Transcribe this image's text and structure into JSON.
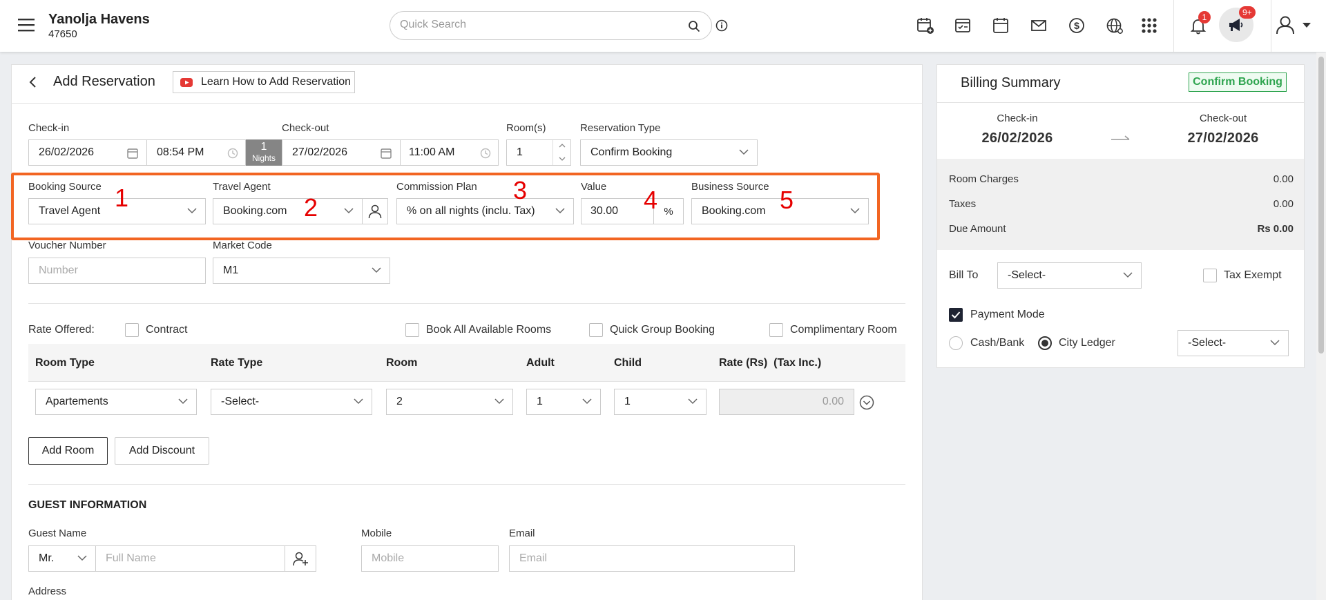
{
  "header": {
    "hotel_name": "Yanolja Havens",
    "hotel_id": "47650",
    "search_placeholder": "Quick Search",
    "notification_count": "1",
    "announcement_count": "9+"
  },
  "page": {
    "title": "Add Reservation",
    "learn_label": "Learn How to Add Reservation"
  },
  "stay": {
    "checkin_label": "Check-in",
    "checkin_date": "26/02/2026",
    "checkin_time": "08:54 PM",
    "nights_count": "1",
    "nights_label": "Nights",
    "checkout_label": "Check-out",
    "checkout_date": "27/02/2026",
    "checkout_time": "11:00 AM",
    "rooms_label": "Room(s)",
    "rooms_value": "1",
    "type_label": "Reservation Type",
    "type_value": "Confirm Booking"
  },
  "source": {
    "booking_source_label": "Booking Source",
    "booking_source_value": "Travel Agent",
    "travel_agent_label": "Travel Agent",
    "travel_agent_value": "Booking.com",
    "commission_label": "Commission Plan",
    "commission_value": "% on all nights (inclu. Tax)",
    "value_label": "Value",
    "value_value": "30.00",
    "value_unit": "%",
    "business_source_label": "Business Source",
    "business_source_value": "Booking.com",
    "markers": [
      "1",
      "2",
      "3",
      "4",
      "5"
    ]
  },
  "misc": {
    "voucher_label": "Voucher Number",
    "voucher_placeholder": "Number",
    "market_label": "Market Code",
    "market_value": "M1"
  },
  "rate_options": {
    "label": "Rate Offered:",
    "contract": "Contract",
    "book_all": "Book All Available Rooms",
    "quick_group": "Quick Group Booking",
    "complimentary": "Complimentary Room"
  },
  "room_table": {
    "headers": [
      "Room Type",
      "Rate Type",
      "Room",
      "Adult",
      "Child",
      "Rate (Rs)  (Tax Inc.)"
    ],
    "row": {
      "room_type": "Apartements",
      "rate_type": "-Select-",
      "room": "2",
      "adult": "1",
      "child": "1",
      "rate": "0.00"
    }
  },
  "actions": {
    "add_room": "Add Room",
    "add_discount": "Add Discount"
  },
  "guest": {
    "section_title": "GUEST INFORMATION",
    "name_label": "Guest Name",
    "salutation": "Mr.",
    "name_placeholder": "Full Name",
    "mobile_label": "Mobile",
    "mobile_placeholder": "Mobile",
    "email_label": "Email",
    "email_placeholder": "Email",
    "address_label": "Address"
  },
  "billing": {
    "title": "Billing Summary",
    "status": "Confirm Booking",
    "checkin_label": "Check-in",
    "checkin_date": "26/02/2026",
    "checkout_label": "Check-out",
    "checkout_date": "27/02/2026",
    "room_charges_label": "Room Charges",
    "room_charges_value": "0.00",
    "taxes_label": "Taxes",
    "taxes_value": "0.00",
    "due_label": "Due Amount",
    "due_value": "Rs 0.00",
    "bill_to_label": "Bill To",
    "bill_to_value": "-Select-",
    "tax_exempt_label": "Tax Exempt",
    "payment_mode_label": "Payment Mode",
    "cash_bank_label": "Cash/Bank",
    "city_ledger_label": "City Ledger",
    "ledger_select": "-Select-"
  },
  "colors": {
    "highlight_border": "#f26522",
    "marker_red": "#e60000",
    "status_green": "#2ea44f",
    "badge_red": "#e53935"
  }
}
